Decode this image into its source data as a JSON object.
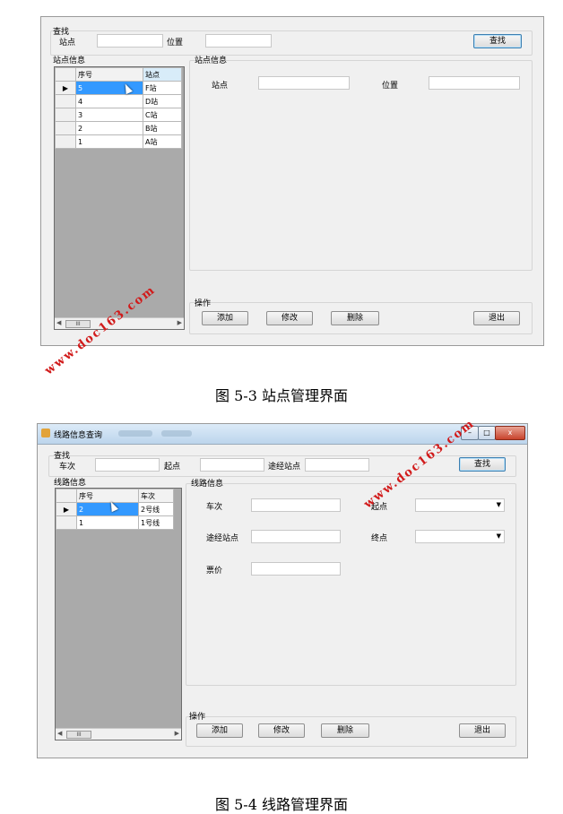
{
  "fig1": {
    "search_group": "查找",
    "station_label": "站点",
    "location_label": "位置",
    "search_button": "查找",
    "list_group": "站点信息",
    "columns": [
      "序号",
      "站点"
    ],
    "rows": [
      [
        "5",
        "F站"
      ],
      [
        "4",
        "D站"
      ],
      [
        "3",
        "C站"
      ],
      [
        "2",
        "B站"
      ],
      [
        "1",
        "A站"
      ]
    ],
    "detail_group": "站点信息",
    "detail_station_label": "站点",
    "detail_location_label": "位置",
    "ops_group": "操作",
    "add_button": "添加",
    "edit_button": "修改",
    "delete_button": "删除",
    "exit_button": "退出",
    "caption": "图 5-3 站点管理界面"
  },
  "fig2": {
    "title": "线路信息查询",
    "search_group": "查找",
    "train_label": "车次",
    "start_label": "起点",
    "via_label": "途经站点",
    "search_button": "查找",
    "list_group": "线路信息",
    "columns": [
      "序号",
      "车次"
    ],
    "rows": [
      [
        "2",
        "2号线"
      ],
      [
        "1",
        "1号线"
      ]
    ],
    "detail_group": "线路信息",
    "detail_train_label": "车次",
    "detail_start_label": "起点",
    "detail_via_label": "途经站点",
    "detail_end_label": "终点",
    "detail_price_label": "票价",
    "ops_group": "操作",
    "add_button": "添加",
    "edit_button": "修改",
    "delete_button": "删除",
    "exit_button": "退出",
    "caption": "图 5-4  线路管理界面"
  },
  "watermark": "www.doc163.com",
  "colors": {
    "selection": "#3399ff",
    "watermark": "#d11a1a",
    "form_bg": "#f0f0f0"
  }
}
